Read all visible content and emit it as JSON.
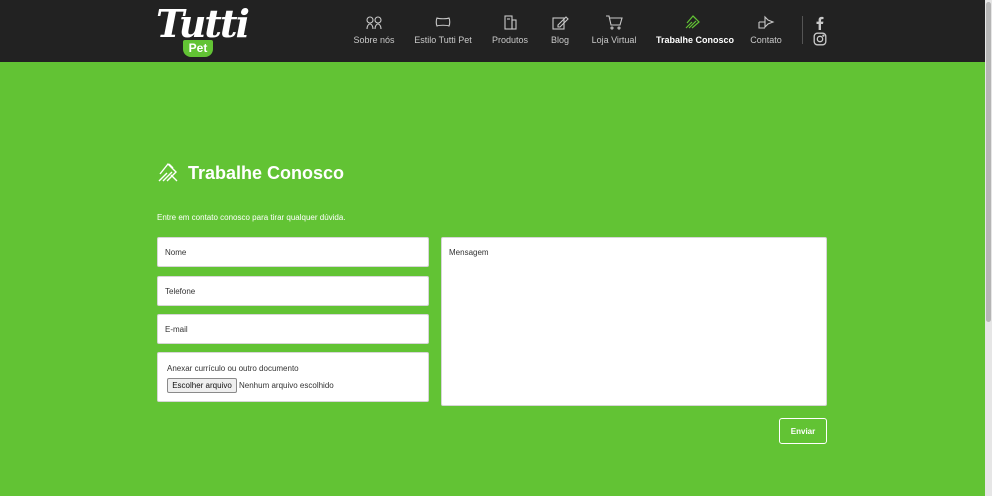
{
  "brand": {
    "name": "Tutti",
    "badge": "Pet"
  },
  "nav": {
    "items": [
      {
        "label": "Sobre nós",
        "icon": "dogs-icon"
      },
      {
        "label": "Estilo Tutti Pet",
        "icon": "bone-icon"
      },
      {
        "label": "Produtos",
        "icon": "products-icon"
      },
      {
        "label": "Blog",
        "icon": "pencil-icon"
      },
      {
        "label": "Loja Virtual",
        "icon": "cart-icon"
      },
      {
        "label": "Trabalhe Conosco",
        "icon": "handshake-icon",
        "active": true
      },
      {
        "label": "Contato",
        "icon": "paw-icon"
      }
    ],
    "social": [
      "facebook-icon",
      "instagram-icon"
    ]
  },
  "page": {
    "title": "Trabalhe Conosco",
    "intro": "Entre em contato conosco para tirar qualquer dúvida."
  },
  "form": {
    "name_placeholder": "Nome",
    "phone_placeholder": "Telefone",
    "email_placeholder": "E-mail",
    "upload_label": "Anexar currículo ou outro documento",
    "file_button": "Escolher arquivo",
    "file_status": "Nenhum arquivo escolhido",
    "message_placeholder": "Mensagem",
    "submit_label": "Enviar"
  },
  "colors": {
    "header_bg": "#222222",
    "brand_green": "#62c334",
    "text_light": "#ffffff",
    "nav_text": "#c9c9c9"
  }
}
